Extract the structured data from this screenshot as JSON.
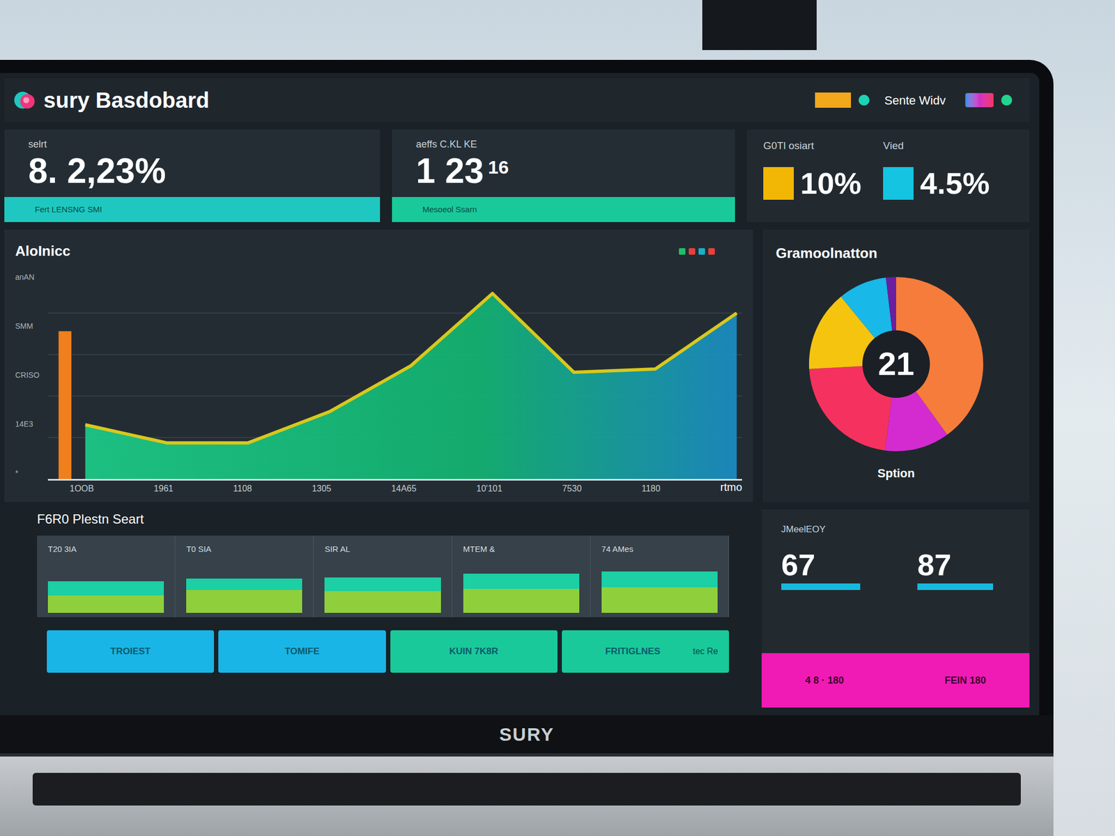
{
  "window": {
    "title": "sury Basdobard"
  },
  "header": {
    "status": "Sente Widv"
  },
  "cards": [
    {
      "label": "selrt",
      "value": "8. 2,23%",
      "sup": "",
      "bar": "Fert LENSNG SMI",
      "color": "#1ec8c0"
    },
    {
      "label": "aeffs C.KL KE",
      "value": "1 23",
      "sup": "16",
      "bar": "Mesoeol Ssarn",
      "color": "#19c99a"
    }
  ],
  "stats": [
    {
      "label": "G0Tl osiart",
      "value": "10%",
      "color": "#f2b705"
    },
    {
      "label": "Vied",
      "value": "4.5%",
      "color": "#14c4e0"
    }
  ],
  "chart": {
    "title": "AloInicc",
    "legend": [
      {
        "color": "#1fbf6a"
      },
      {
        "color": "#e8403a"
      },
      {
        "color": "#1ab0c8"
      },
      {
        "color": "#e8403a"
      }
    ],
    "y_ticks": [
      "anAN",
      "SMM",
      "CRISO",
      "14E3",
      "*"
    ],
    "x_ticks": [
      "1OOB",
      "1961",
      "1108",
      "1305",
      "14A65",
      "10'101",
      "7530",
      "1180",
      "rtmo"
    ],
    "max": 120,
    "bar": [
      90
    ],
    "line": [
      33,
      22,
      22,
      41,
      69,
      113,
      65,
      67,
      101
    ]
  },
  "donut": {
    "title": "Gramoolnatton",
    "center": "21",
    "caption": "Sption",
    "segments": [
      {
        "value": 40,
        "color": "#f57c3a"
      },
      {
        "value": 12,
        "color": "#d42bd0"
      },
      {
        "value": 22,
        "color": "#f5325f"
      },
      {
        "value": 15,
        "color": "#f5c40f"
      },
      {
        "value": 9,
        "color": "#18b8e8"
      },
      {
        "value": 2,
        "color": "#6a1fa0"
      }
    ]
  },
  "section": {
    "title": "F6R0 Plestn Seart",
    "tiles": [
      {
        "label": "T20 3IA",
        "top": 0.55,
        "bottom": 0.3
      },
      {
        "label": "T0 SIA",
        "top": 0.6,
        "bottom": 0.4
      },
      {
        "label": "SIR AL",
        "top": 0.62,
        "bottom": 0.38
      },
      {
        "label": "MTEM &",
        "top": 0.68,
        "bottom": 0.42
      },
      {
        "label": "74 AMes",
        "top": 0.72,
        "bottom": 0.45
      }
    ]
  },
  "buttons": [
    {
      "label": "TROIEST",
      "hint": "",
      "color": "#19b5e6"
    },
    {
      "label": "TOMIFE",
      "hint": "",
      "color": "#19b5e6"
    },
    {
      "label": "KUIN 7K8R",
      "hint": "",
      "color": "#19c99a"
    },
    {
      "label": "FRITIGLNES",
      "hint": "tec Re",
      "color": "#19c99a"
    }
  ],
  "summary": {
    "label": "JMeelEOY",
    "values": [
      {
        "value": "67",
        "level": 0.85
      },
      {
        "value": "87",
        "level": 0.82
      }
    ],
    "footer": [
      "4 8 · 180",
      "FEIN 180"
    ]
  },
  "brand": "SURY"
}
